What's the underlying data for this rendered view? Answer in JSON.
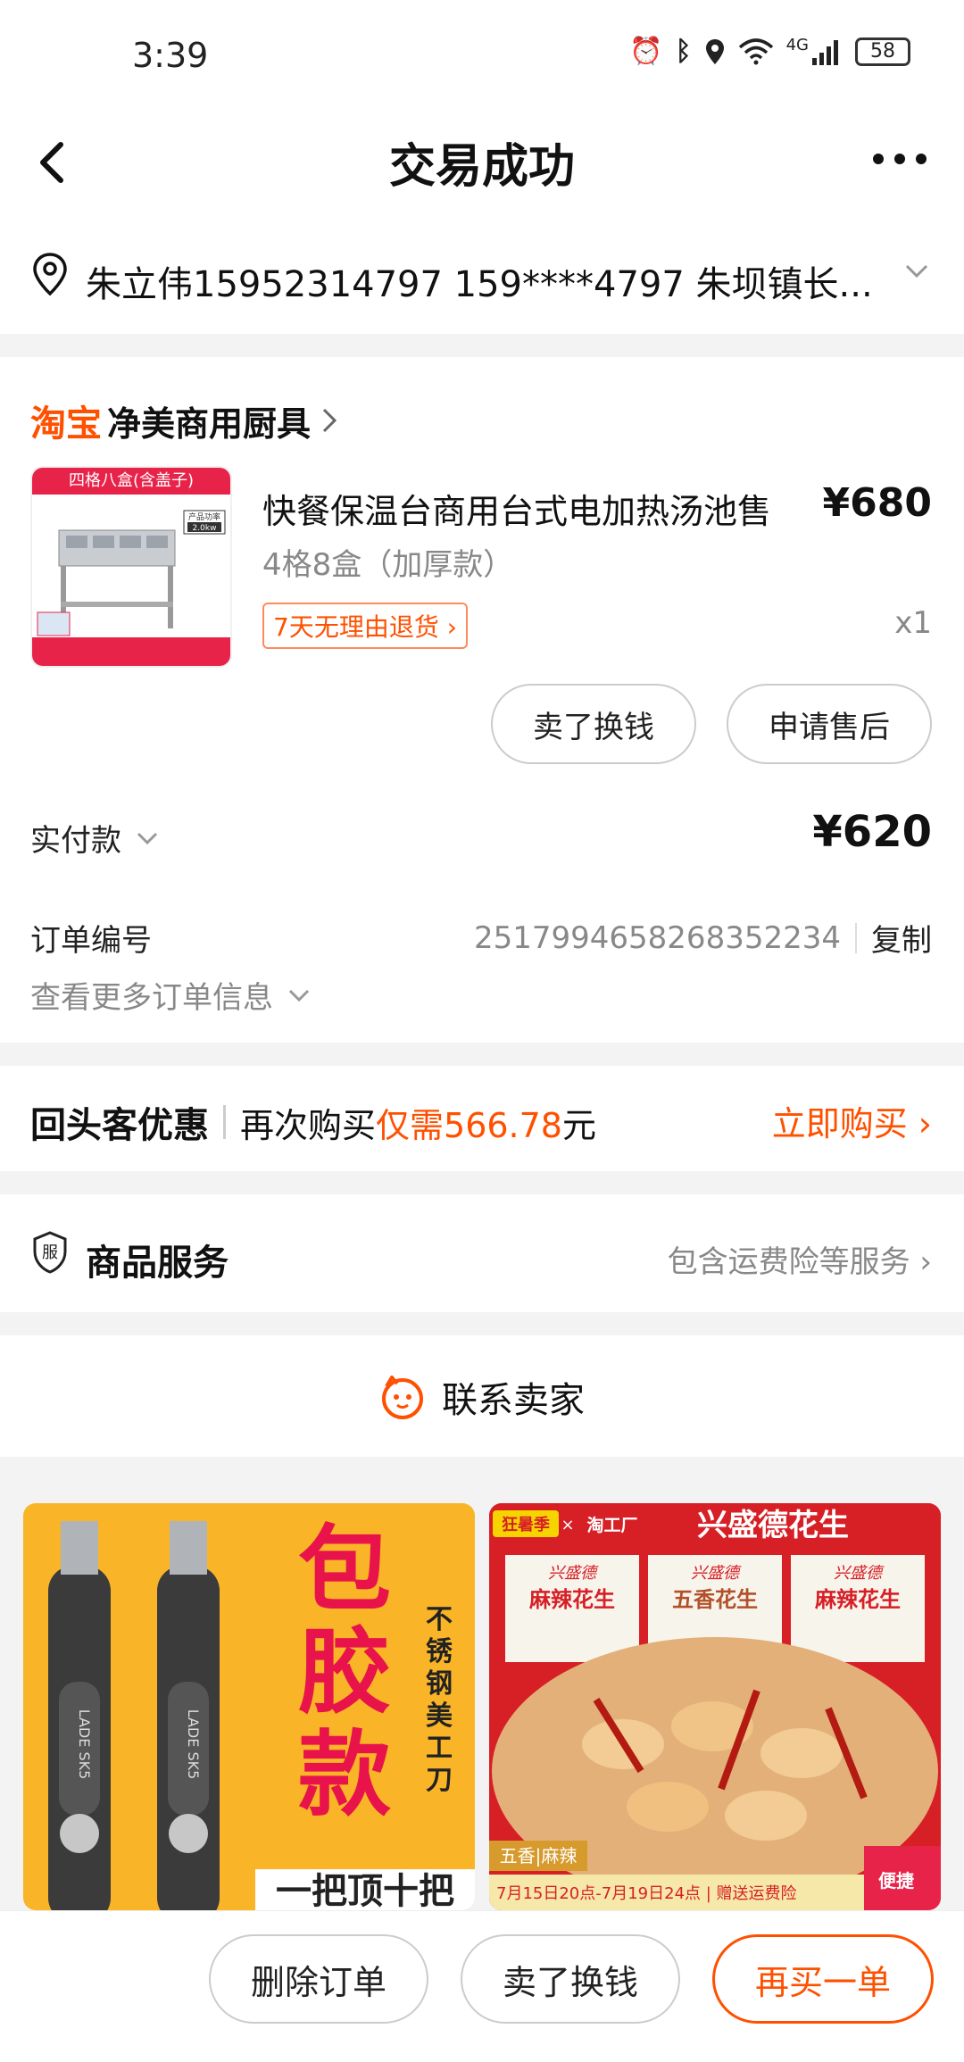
{
  "status_bar": {
    "time": "3:39",
    "network": "4G",
    "battery": "58"
  },
  "nav": {
    "title": "交易成功"
  },
  "address": {
    "text": "朱立伟15952314797  159****4797  朱坝镇长..."
  },
  "shop": {
    "platform": "淘宝",
    "name": "净美商用厨具"
  },
  "product": {
    "title": "快餐保温台商用台式电加热汤池售",
    "price": "¥680",
    "spec": "4格8盒（加厚款）",
    "tag": "7天无理由退货 ›",
    "qty": "x1",
    "image_header": "四格八盒(含盖子)",
    "image_badge": "产品功率",
    "image_badge_value": "2.0kw"
  },
  "product_actions": {
    "sell": "卖了换钱",
    "after_sales": "申请售后"
  },
  "payment": {
    "label": "实付款",
    "amount": "¥620"
  },
  "order": {
    "label": "订单编号",
    "number": "2517994658268352234",
    "copy": "复制",
    "more": "查看更多订单信息"
  },
  "promo": {
    "title": "回头客优惠",
    "text_prefix": "再次购买",
    "price_text": "仅需566.78",
    "text_suffix": "元",
    "buy": "立即购买 ›"
  },
  "service": {
    "title": "商品服务",
    "desc": "包含运费险等服务 ›",
    "icon_text": "服"
  },
  "contact": {
    "label": "联系卖家"
  },
  "recommend_left": {
    "big": [
      "包",
      "胶",
      "款"
    ],
    "side": [
      "不",
      "锈",
      "钢",
      "美",
      "工",
      "刀"
    ],
    "blade_text": "LADE SK5",
    "bottom": "一把顶十把"
  },
  "recommend_right": {
    "tag1": "狂暑季",
    "tag2": "淘工厂",
    "brand": "兴盛德花生",
    "packs": [
      {
        "brand": "兴盛德",
        "flavor": "麻辣花生"
      },
      {
        "brand": "兴盛德",
        "flavor": "五香花生"
      },
      {
        "brand": "兴盛德",
        "flavor": "麻辣花生"
      }
    ],
    "badge": "五香|麻辣",
    "footer": "7月15日20点-7月19日24点 | 赠送运费险",
    "corner": "便捷"
  },
  "bottom_bar": {
    "delete": "删除订单",
    "sell": "卖了换钱",
    "rebuy": "再买一单"
  },
  "colors": {
    "accent": "#ff5000",
    "bg": "#f3f3f3"
  }
}
